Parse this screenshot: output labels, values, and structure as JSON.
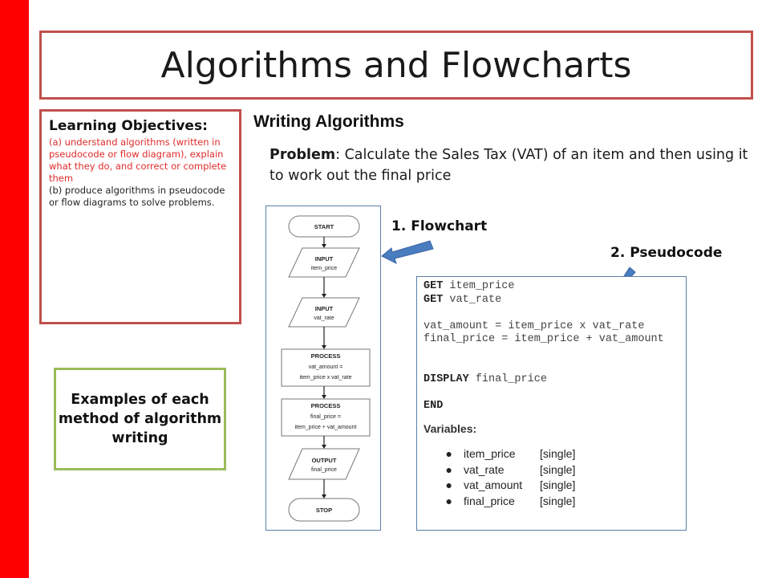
{
  "slide": {
    "title": "Algorithms and Flowcharts",
    "accent_color": "#ff0000",
    "frame_color": "#c0504d",
    "green_frame_color": "#9bbb59",
    "arrow_color": "#4a7cc0"
  },
  "learning_objectives": {
    "heading": "Learning Objectives:",
    "item_a": "(a) understand algorithms (written in pseudocode or flow diagram), explain what they do, and correct or complete them",
    "item_b": "(b) produce algorithms in pseudocode or flow diagrams to solve problems."
  },
  "examples_note": "Examples of each method of algorithm writing",
  "section": {
    "heading": "Writing Algorithms",
    "problem_label": "Problem",
    "problem_text": ": Calculate the Sales Tax (VAT) of an item and then using it to work out the final price"
  },
  "labels": {
    "flowchart": "1. Flowchart",
    "pseudocode": "2. Pseudocode"
  },
  "flowchart": {
    "steps": [
      {
        "shape": "terminator",
        "title": "START",
        "text": ""
      },
      {
        "shape": "io",
        "title": "INPUT",
        "text": "item_price"
      },
      {
        "shape": "io",
        "title": "INPUT",
        "text": "vat_rate"
      },
      {
        "shape": "process",
        "title": "PROCESS",
        "text": "vat_amount =",
        "text2": "item_price x vat_rate"
      },
      {
        "shape": "process",
        "title": "PROCESS",
        "text": "final_price =",
        "text2": "item_price + vat_amount"
      },
      {
        "shape": "io",
        "title": "OUTPUT",
        "text": "final_price"
      },
      {
        "shape": "terminator",
        "title": "STOP",
        "text": ""
      }
    ]
  },
  "pseudocode": {
    "lines": [
      {
        "kw": "GET",
        "rest": " item_price"
      },
      {
        "kw": "GET",
        "rest": " vat_rate"
      },
      {
        "kw": "",
        "rest": ""
      },
      {
        "kw": "",
        "rest": "vat_amount = item_price x vat_rate"
      },
      {
        "kw": "",
        "rest": "final_price = item_price + vat_amount"
      },
      {
        "kw": "",
        "rest": ""
      },
      {
        "kw": "",
        "rest": ""
      },
      {
        "kw": "DISPLAY",
        "rest": " final_price"
      },
      {
        "kw": "",
        "rest": ""
      },
      {
        "kw": "END",
        "rest": ""
      }
    ],
    "variables_heading": "Variables:",
    "variables": [
      {
        "name": "item_price",
        "type": "[single]"
      },
      {
        "name": "vat_rate",
        "type": "[single]"
      },
      {
        "name": "vat_amount",
        "type": "[single]"
      },
      {
        "name": "final_price",
        "type": "[single]"
      }
    ]
  }
}
